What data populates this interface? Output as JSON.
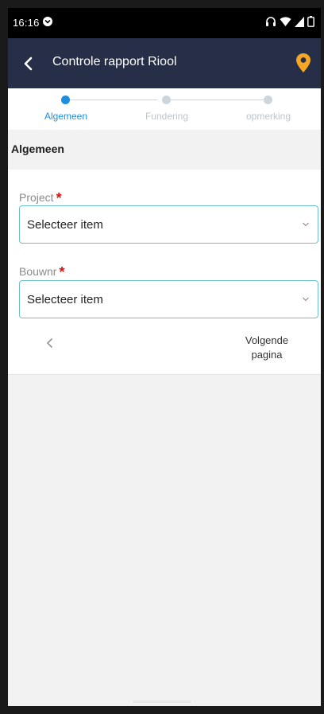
{
  "status_bar": {
    "time": "16:16",
    "icons": [
      "do-not-disturb-icon",
      "headset-icon",
      "wifi-icon",
      "signal-icon",
      "battery-icon"
    ]
  },
  "app_bar": {
    "title": "Controle rapport Riool",
    "accent_color": "#f5a623",
    "background": "#262f47"
  },
  "stepper": {
    "steps": [
      {
        "label": "Algemeen",
        "active": true
      },
      {
        "label": "Fundering",
        "active": false
      },
      {
        "label": "opmerking",
        "active": false
      }
    ],
    "active_color": "#1f8ee0"
  },
  "section": {
    "title": "Algemeen"
  },
  "form": {
    "fields": [
      {
        "label": "Project",
        "required_mark": "*",
        "value": "Selecteer item"
      },
      {
        "label": "Bouwnr",
        "required_mark": "*",
        "value": "Selecteer item"
      }
    ],
    "prev_label": "‹",
    "next_label_line1": "Volgende",
    "next_label_line2": "pagina"
  }
}
